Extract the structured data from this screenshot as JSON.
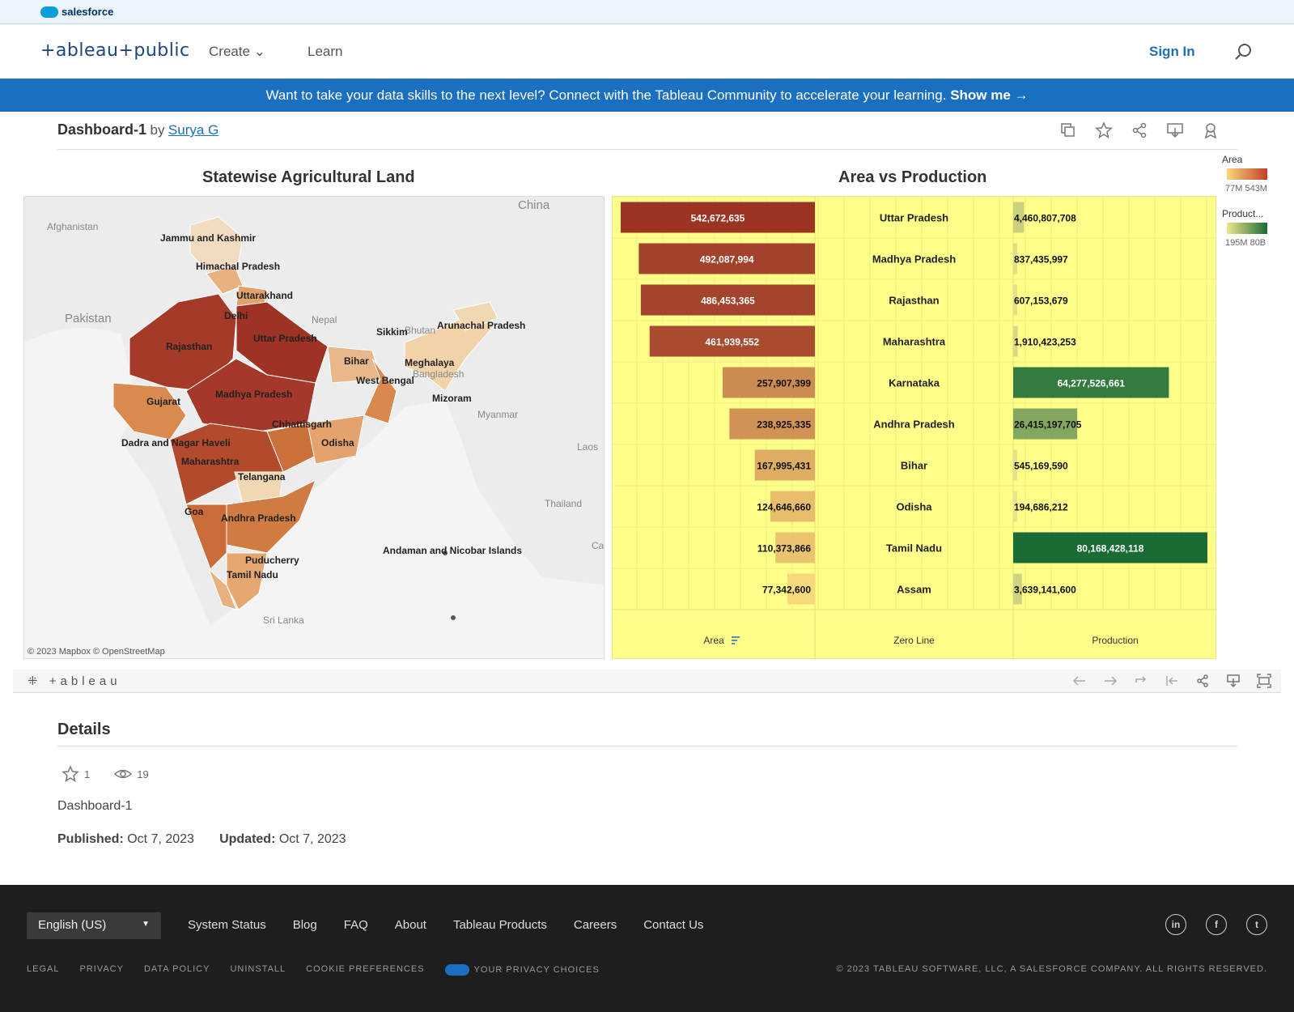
{
  "salesforce": {
    "label": "salesforce"
  },
  "header": {
    "logo": "+ableau+public",
    "create": "Create",
    "learn": "Learn",
    "sign_in": "Sign In"
  },
  "banner": {
    "text": "Want to take your data skills to the next level? Connect with the Tableau Community to accelerate your learning.",
    "cta": "Show me →"
  },
  "viz": {
    "title": "Dashboard-1",
    "by": "by",
    "author": "Surya G"
  },
  "map": {
    "title": "Statewise Agricultural Land",
    "credit": "© 2023 Mapbox  © OpenStreetMap",
    "countries": [
      "China",
      "Afghanistan",
      "Pakistan",
      "Nepal",
      "Bhutan",
      "Bangladesh",
      "Myanmar",
      "Laos",
      "Thailand",
      "Sri Lanka",
      "Cambodia"
    ],
    "states": [
      "Jammu and Kashmir",
      "Himachal Pradesh",
      "Uttarakhand",
      "Delhi",
      "Uttar Pradesh",
      "Rajasthan",
      "Sikkim",
      "Arunachal Pradesh",
      "Bihar",
      "Meghalaya",
      "West Bengal",
      "Gujarat",
      "Madhya Pradesh",
      "Mizoram",
      "Chhattisgarh",
      "Odisha",
      "Dadra and Nagar Haveli",
      "Maharashtra",
      "Telangana",
      "Goa",
      "Andhra Pradesh",
      "Andaman and Nicobar Islands",
      "Puducherry",
      "Tamil Nadu"
    ]
  },
  "chart_data": {
    "type": "bar",
    "title": "Area vs Production",
    "categories": [
      "Uttar Pradesh",
      "Madhya Pradesh",
      "Rajasthan",
      "Maharashtra",
      "Karnataka",
      "Andhra Pradesh",
      "Bihar",
      "Odisha",
      "Tamil Nadu",
      "Assam"
    ],
    "series": [
      {
        "name": "Area",
        "values": [
          542672635,
          492087994,
          486453365,
          461939552,
          257907399,
          238925335,
          167995431,
          124646660,
          110373866,
          77342600
        ]
      },
      {
        "name": "Production",
        "values": [
          4460807708,
          837435997,
          607153679,
          1910423253,
          64277526661,
          26415197705,
          545169590,
          194686212,
          80168428118,
          3639141600
        ]
      }
    ],
    "value_labels": {
      "area": [
        "542,672,635",
        "492,087,994",
        "486,453,365",
        "461,939,552",
        "257,907,399",
        "238,925,335",
        "167,995,431",
        "124,646,660",
        "110,373,866",
        "77,342,600"
      ],
      "production": [
        "4,460,807,708",
        "837,435,997",
        "607,153,679",
        "1,910,423,253",
        "64,277,526,661",
        "26,415,197,705",
        "545,169,590",
        "194,686,212",
        "80,168,428,118",
        "3,639,141,600"
      ]
    },
    "columns": [
      "Area",
      "Zero Line",
      "Production"
    ],
    "colors": {
      "area_low": "#f7d87a",
      "area_high": "#9b3423",
      "prod_low": "#f0e68c",
      "prod_high": "#1a6b34",
      "background": "#ffff8a"
    }
  },
  "legend": {
    "area_title": "Area",
    "area_range": "77M  543M",
    "prod_title": "Product...",
    "prod_range": "195M  80B"
  },
  "toolbar": {
    "logo": "+ableau"
  },
  "details": {
    "heading": "Details",
    "favorites": "1",
    "views": "19",
    "description": "Dashboard-1",
    "published_label": "Published:",
    "published": "Oct 7, 2023",
    "updated_label": "Updated:",
    "updated": "Oct 7, 2023"
  },
  "footer": {
    "language": "English (US)",
    "links": [
      "System Status",
      "Blog",
      "FAQ",
      "About",
      "Tableau Products",
      "Careers",
      "Contact Us"
    ],
    "legal": [
      "LEGAL",
      "PRIVACY",
      "DATA POLICY",
      "UNINSTALL",
      "COOKIE PREFERENCES",
      "YOUR PRIVACY CHOICES"
    ],
    "copyright": "© 2023 TABLEAU SOFTWARE, LLC, A SALESFORCE COMPANY. ALL RIGHTS RESERVED.",
    "social": [
      "in",
      "f",
      "t"
    ]
  }
}
